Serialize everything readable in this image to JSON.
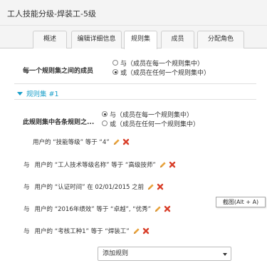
{
  "window": {
    "title": "工人技能分级-焊装工-5级"
  },
  "tabs": [
    {
      "label": "概述"
    },
    {
      "label": "编辑详细信息"
    },
    {
      "label": "规则集"
    },
    {
      "label": "成员"
    },
    {
      "label": "分配角色"
    }
  ],
  "between_sets": {
    "label": "每一个规则集之间的成员",
    "option_and": "与（成员在每一个规则集中）",
    "option_or": "或（成员在任何一个规则集中）",
    "selected": "or"
  },
  "rule_set": {
    "title": "规则集 #1",
    "within_label": "此规则集中各条规则之...",
    "option_and": "与（成员在每一个规则集中）",
    "option_or": "或（成员在任何一个规则集中）",
    "selected": "and",
    "rules": [
      {
        "prefix": "",
        "text": "用户的  “技能等级”  等于 “4”"
      },
      {
        "prefix": "与",
        "text": "用户的  “工人技术等级名称”  等于  “高级技师”"
      },
      {
        "prefix": "与",
        "text": "用户的  “认证时间”  在 02/01/2015 之前"
      },
      {
        "prefix": "与",
        "text": "用户的  “2016年绩效”  等于  “卓越”, “优秀”"
      },
      {
        "prefix": "与",
        "text": "用户的  “考核工种1”  等于  “焊装工”"
      }
    ]
  },
  "tooltip": "截图(Alt + A)",
  "add_rule": {
    "label": "添加规则"
  },
  "colors": {
    "link": "#1a9fc9",
    "pencil": "#e8a23a",
    "delete": "#d9402b"
  },
  "icons": {
    "edit": "pencil-icon",
    "delete": "x-icon",
    "expand": "caret-down-icon",
    "dropdown": "chevron-down-icon"
  }
}
